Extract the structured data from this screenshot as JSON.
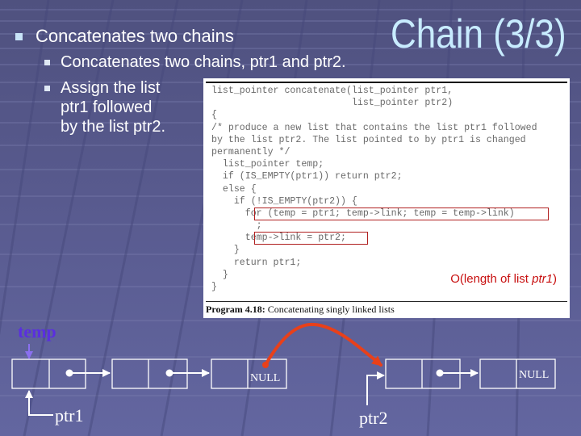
{
  "slide": {
    "title": "Chain (3/3)",
    "bullets": [
      {
        "level": 1,
        "text": "Concatenates two chains"
      },
      {
        "level": 2,
        "text": "Concatenates two chains, ptr1 and ptr2."
      },
      {
        "level": 2,
        "lines": [
          "Assign the list",
          "ptr1 followed",
          "by the list ptr2."
        ]
      }
    ]
  },
  "code_figure": {
    "lines": [
      "list_pointer concatenate(list_pointer ptr1,",
      "                         list_pointer ptr2)",
      "{",
      "/* produce a new list that contains the list ptr1 followed",
      "by the list ptr2. The list pointed to by ptr1 is changed",
      "permanently */",
      "  list_pointer temp;",
      "  if (IS_EMPTY(ptr1)) return ptr2;",
      "  else {",
      "    if (!IS_EMPTY(ptr2)) {",
      "      for (temp = ptr1; temp->link; temp = temp->link)",
      "        ;",
      "      temp->link = ptr2;",
      "    }",
      "    return ptr1;",
      "  }",
      "}"
    ],
    "highlighted_lines": [
      10,
      12
    ],
    "complexity_prefix": "O(length of list ",
    "complexity_var": "ptr1",
    "complexity_suffix": ")",
    "caption_label": "Program 4.18:",
    "caption_text": " Concatenating singly linked lists"
  },
  "diagram": {
    "temp_label": "temp",
    "ptr1_label": "ptr1",
    "ptr2_label": "ptr2",
    "null_label": "NULL",
    "list1_nodes": 3,
    "list2_nodes": 2,
    "colors": {
      "node_outline": "#ffffff",
      "temp_label": "#5a2ee0",
      "temp_arrow": "#8a70f0",
      "concat_arrow": "#e8401a",
      "complexity": "#c81010"
    }
  }
}
